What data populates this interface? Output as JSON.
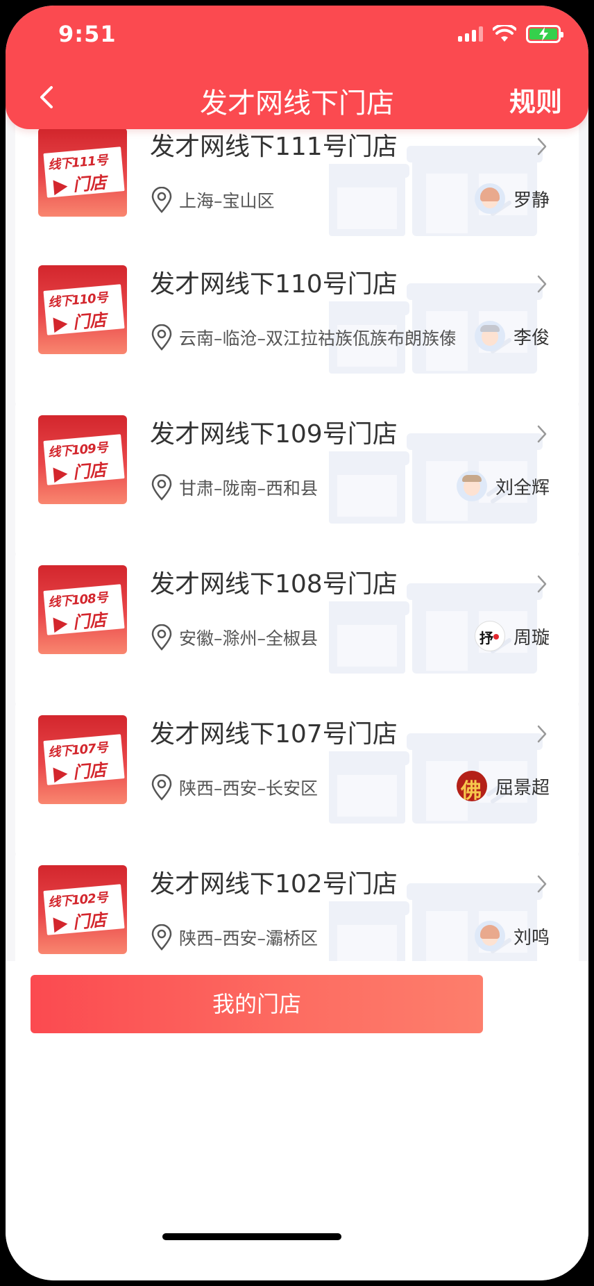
{
  "status_bar": {
    "time": "9:51"
  },
  "nav": {
    "title": "发才网线下门店",
    "rules": "规则"
  },
  "stores": [
    {
      "title": "发才网线下111号门店",
      "logo_num": "线下111号",
      "logo_text": "门店",
      "location": "上海–宝山区",
      "owner": "罗静",
      "avatar": "female"
    },
    {
      "title": "发才网线下110号门店",
      "logo_num": "线下110号",
      "logo_text": "门店",
      "location": "云南–临沧–双江拉祜族佤族布朗族傣族自",
      "owner": "李俊",
      "avatar": "male"
    },
    {
      "title": "发才网线下109号门店",
      "logo_num": "线下109号",
      "logo_text": "门店",
      "location": "甘肃–陇南–西和县",
      "owner": "刘全辉",
      "avatar": "male2"
    },
    {
      "title": "发才网线下108号门店",
      "logo_num": "线下108号",
      "logo_text": "门店",
      "location": "安徽–滁州–全椒县",
      "owner": "周璇",
      "avatar": "ink"
    },
    {
      "title": "发才网线下107号门店",
      "logo_num": "线下107号",
      "logo_text": "门店",
      "location": "陕西–西安–长安区",
      "owner": "屈景超",
      "avatar": "fo"
    },
    {
      "title": "发才网线下102号门店",
      "logo_num": "线下102号",
      "logo_text": "门店",
      "location": "陕西–西安–灞桥区",
      "owner": "刘鸣",
      "avatar": "female"
    }
  ],
  "bottom": {
    "my_store": "我的门店"
  },
  "colors": {
    "brand": "#fb4a50"
  }
}
